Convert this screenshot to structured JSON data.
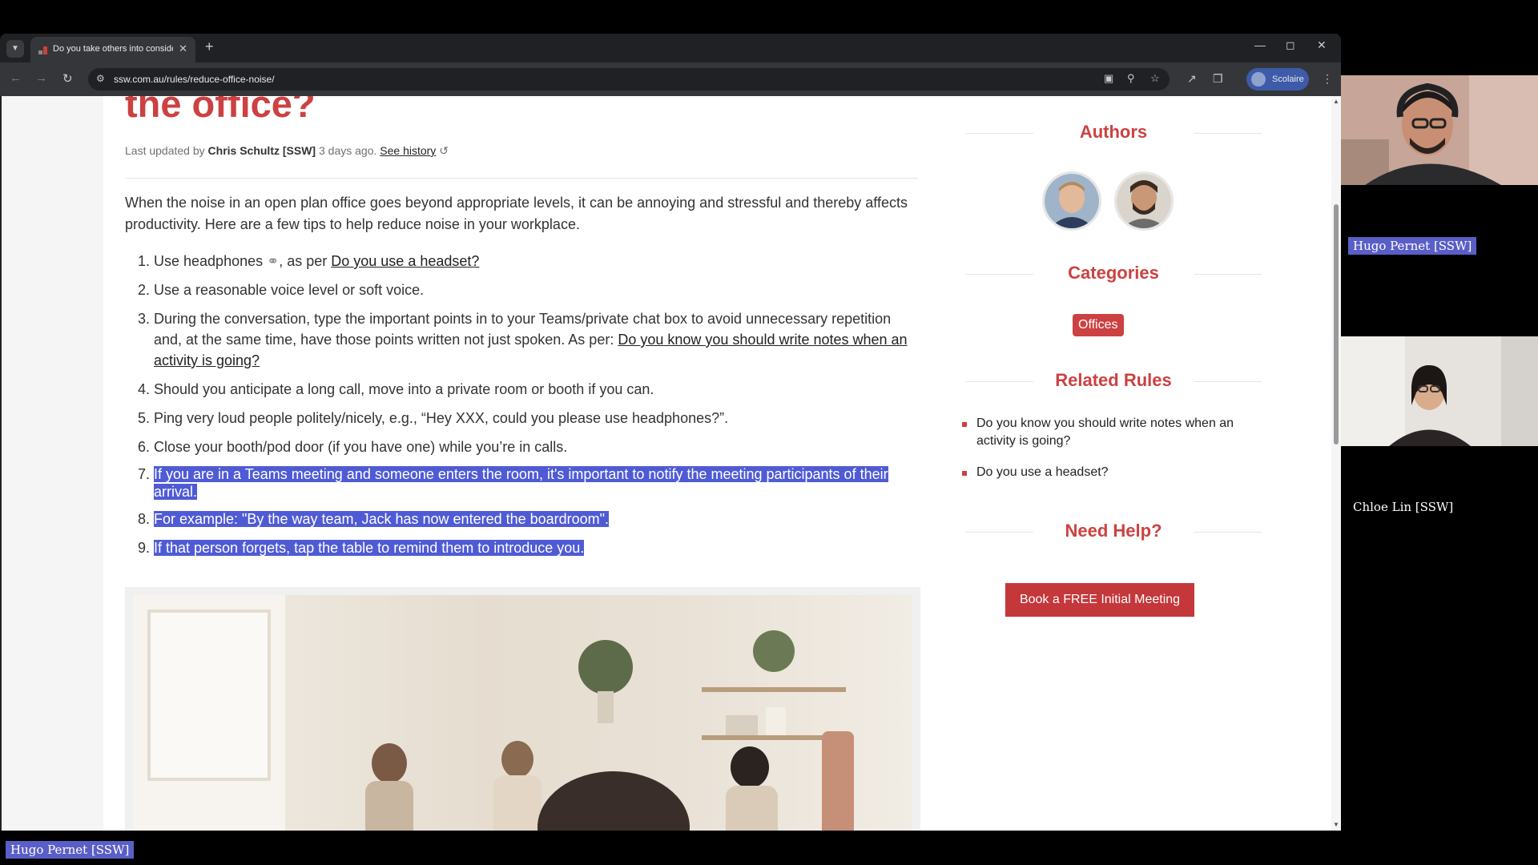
{
  "browser": {
    "tab_title": "Do you take others into consideration",
    "url": "ssw.com.au/rules/reduce-office-noise/",
    "profile_label": "Scolaire"
  },
  "article": {
    "title_partial": "the office?",
    "meta": {
      "prefix": "Last updated by",
      "author": "Chris Schultz [SSW]",
      "when": "3 days ago.",
      "history_link": "See history"
    },
    "intro": "When the noise in an open plan office goes beyond appropriate levels, it can be annoying and stressful and thereby affects productivity. Here are a few tips to help reduce noise in your workplace.",
    "items": [
      {
        "num": "1.",
        "pre": "Use headphones",
        "post": ", as per",
        "link": "Do you use a headset?"
      },
      {
        "num": "2.",
        "text": "Use a reasonable voice level or soft voice."
      },
      {
        "num": "3.",
        "pre": "During the conversation, type the important points in to your Teams/private chat box to avoid unnecessary repetition and, at the same time, have those points written not just spoken. As per:",
        "link": "Do you know you should write notes when an activity is going?"
      },
      {
        "num": "4.",
        "text": "Should you anticipate a long call, move into a private room or booth if you can."
      },
      {
        "num": "5.",
        "text": "Ping very loud people politely/nicely, e.g., “Hey XXX, could you please use headphones?”."
      },
      {
        "num": "6.",
        "text": "Close your booth/pod door (if you have one) while you’re in calls."
      },
      {
        "num": "7.",
        "text": "If you are in a Teams meeting and someone enters the room, it's important to notify the meeting participants of their arrival."
      },
      {
        "num": "8.",
        "text": "For example: \"By the way team, Jack has now entered the boardroom\"."
      },
      {
        "num": "9.",
        "text": "If that person forgets, tap the table to remind them to introduce you."
      }
    ]
  },
  "sidebar": {
    "authors_heading": "Authors",
    "categories_heading": "Categories",
    "category": "Offices",
    "related_heading": "Related Rules",
    "related": [
      "Do you know you should write notes when an activity is going?",
      "Do you use a headset?"
    ],
    "help_heading": "Need Help?",
    "book_button": "Book a FREE Initial Meeting"
  },
  "call": {
    "participant_1": "Hugo Pernet [SSW]",
    "participant_2": "Chloe Lin [SSW]",
    "presenter": "Hugo Pernet [SSW]"
  },
  "colors": {
    "brand_red": "#cc4141",
    "selection": "#4f5bd5",
    "name_tag": "#5a5fc7"
  }
}
